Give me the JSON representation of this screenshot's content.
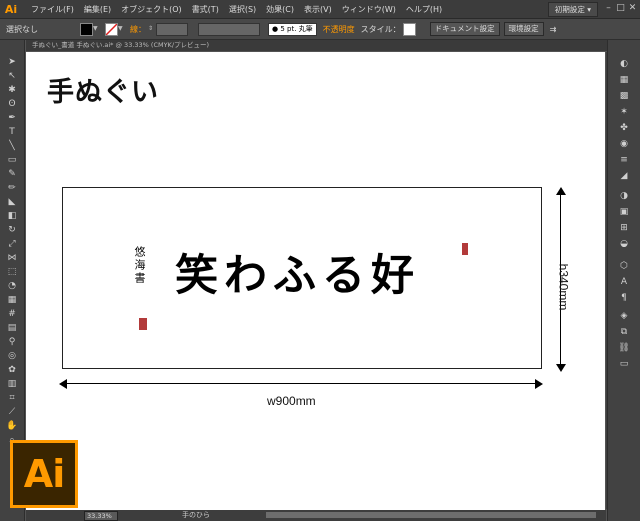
{
  "app": {
    "logo_text": "Ai",
    "accent_color": "#ff9a00",
    "workspace_label": "初期設定 ▾"
  },
  "menu": {
    "items": [
      "ファイル(F)",
      "編集(E)",
      "オブジェクト(O)",
      "書式(T)",
      "選択(S)",
      "効果(C)",
      "表示(V)",
      "ウィンドウ(W)",
      "ヘルプ(H)"
    ]
  },
  "controlbar": {
    "selection_label": "選択なし",
    "stroke_label": "線：",
    "stroke_preview": "● 5 pt. 丸筆",
    "opacity_label": "不透明度",
    "style_label": "スタイル：",
    "doc_settings_button": "ドキュメント設定",
    "preferences_button": "環境設定"
  },
  "document_tab": {
    "title": "手ぬぐい_書道 手ぬぐい.ai* @ 33.33% (CMYK/プレビュー)"
  },
  "artboard": {
    "heading": "手ぬぐい",
    "calligraphy": "笑わふる好",
    "signature": "悠海書",
    "width_label": "w900mm",
    "height_label": "h340mm"
  },
  "statusbar": {
    "zoom": "33.33%",
    "tool_status": "手のひら"
  },
  "badge": {
    "text": "Ai"
  }
}
